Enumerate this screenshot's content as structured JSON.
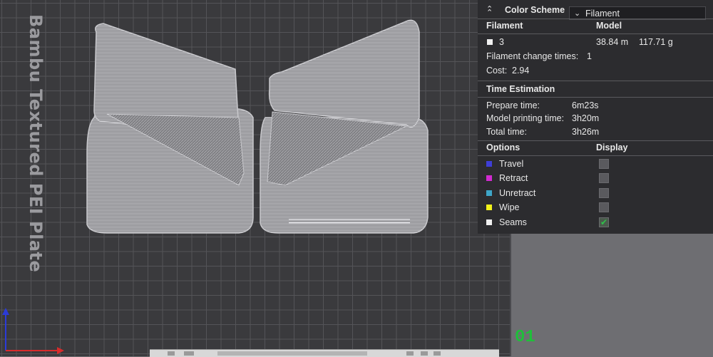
{
  "plate": {
    "label": "Bambu Textured PEI Plate",
    "number": "01"
  },
  "legend": {
    "color_scheme_label": "Color Scheme",
    "color_scheme_value": "Filament",
    "filament_header": "Filament",
    "model_header": "Model",
    "filament_id": "3",
    "filament_length": "38.84 m",
    "filament_weight": "117.71 g",
    "change_times_label": "Filament change times:",
    "change_times_value": "1",
    "cost_label": "Cost:",
    "cost_value": "2.94",
    "time_header": "Time Estimation",
    "prepare_label": "Prepare time:",
    "prepare_value": "6m23s",
    "model_time_label": "Model printing time:",
    "model_time_value": "3h20m",
    "total_label": "Total time:",
    "total_value": "3h26m",
    "options_header": "Options",
    "display_header": "Display",
    "options": [
      {
        "label": "Travel",
        "color": "#3e3ed6",
        "checked": false
      },
      {
        "label": "Retract",
        "color": "#d12ad1",
        "checked": false
      },
      {
        "label": "Unretract",
        "color": "#3ea6c8",
        "checked": false
      },
      {
        "label": "Wipe",
        "color": "#f2f21a",
        "checked": false
      },
      {
        "label": "Seams",
        "color": "#f0f0f0",
        "checked": true
      }
    ]
  },
  "colors": {
    "accent_green": "#1fbf3a",
    "panel_bg": "#2c2c2f"
  }
}
